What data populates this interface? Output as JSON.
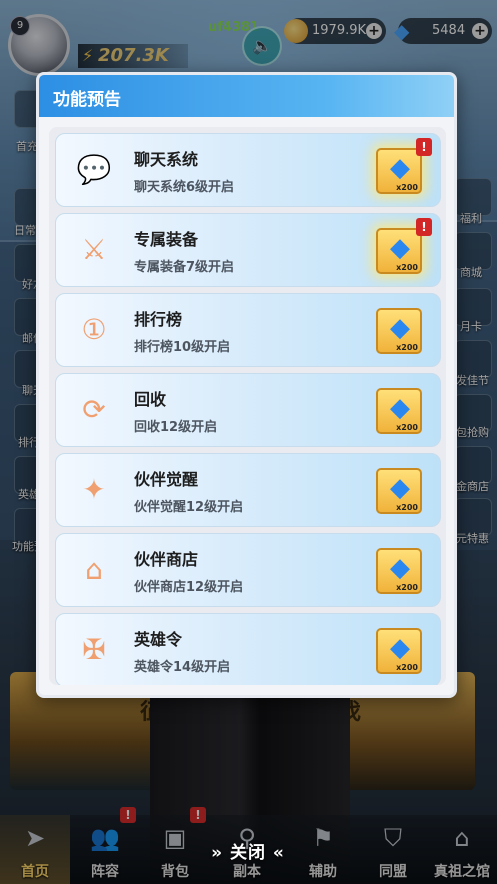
{
  "hud": {
    "level": "9",
    "username": "uf4381",
    "power": "207.3K",
    "gold": "1979.9K",
    "diamonds": "5484"
  },
  "side_left": [
    "首充",
    "日常",
    "好友",
    "邮件",
    "聊天",
    "排行",
    "英雄",
    "功能预"
  ],
  "side_right": [
    "福利",
    "商城",
    "月卡",
    "发佳节",
    "包抢购",
    "金商店",
    "元特惠"
  ],
  "battle": {
    "left": "征战",
    "right": "讨伐"
  },
  "modal": {
    "title": "功能预告",
    "items": [
      {
        "icon": "chat-icon",
        "name": "聊天系统",
        "desc": "聊天系统6级开启",
        "reward_qty": "x200",
        "highlighted": true
      },
      {
        "icon": "exclusive-gear-icon",
        "name": "专属装备",
        "desc": "专属装备7级开启",
        "reward_qty": "x200",
        "highlighted": true
      },
      {
        "icon": "ranking-badge-icon",
        "name": "排行榜",
        "desc": "排行榜10级开启",
        "reward_qty": "x200",
        "highlighted": false
      },
      {
        "icon": "recycle-icon",
        "name": "回收",
        "desc": "回收12级开启",
        "reward_qty": "x200",
        "highlighted": false
      },
      {
        "icon": "awaken-icon",
        "name": "伙伴觉醒",
        "desc": "伙伴觉醒12级开启",
        "reward_qty": "x200",
        "highlighted": false
      },
      {
        "icon": "shop-icon",
        "name": "伙伴商店",
        "desc": "伙伴商店12级开启",
        "reward_qty": "x200",
        "highlighted": false
      },
      {
        "icon": "hero-order-icon",
        "name": "英雄令",
        "desc": "英雄令14级开启",
        "reward_qty": "x200",
        "highlighted": false
      }
    ]
  },
  "nav": {
    "home": "首页",
    "lineup": "阵容",
    "bag": "背包",
    "dungeon": "副本",
    "assist": "辅助",
    "alliance": "同盟",
    "hall": "真祖之馆",
    "close": "» 关闭 «"
  },
  "colors": {
    "header_blue": "#2d8fe4",
    "reward_gold": "#f0b23a",
    "alert_red": "#d32626",
    "active_nav": "#ffd76a"
  }
}
